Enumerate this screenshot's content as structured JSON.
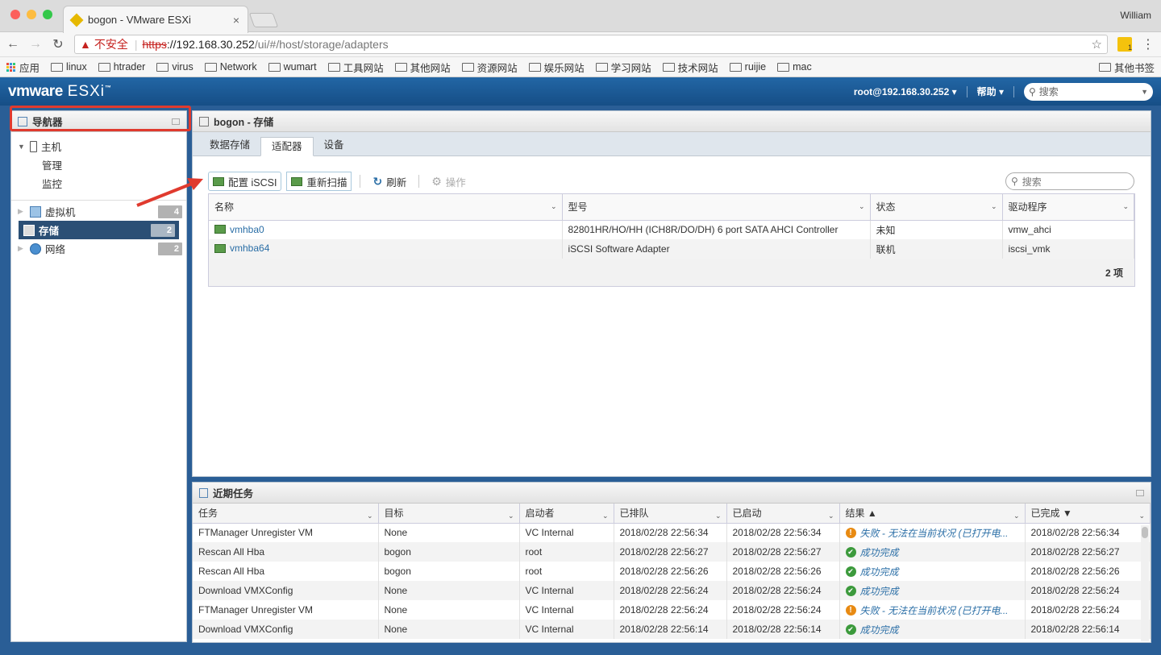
{
  "browser": {
    "tab_title": "bogon - VMware ESXi",
    "user": "William",
    "insecure_label": "不安全",
    "url_scheme": "https",
    "url_host": "://192.168.30.252",
    "url_path": "/ui/#/host/storage/adapters",
    "ext_badge": "1"
  },
  "bookmarks": {
    "apps": "应用",
    "items": [
      "linux",
      "htrader",
      "virus",
      "Network",
      "wumart",
      "工具网站",
      "其他网站",
      "资源网站",
      "娱乐网站",
      "学习网站",
      "技术网站",
      "ruijie",
      "mac"
    ],
    "other": "其他书签"
  },
  "header": {
    "logo": "vmware",
    "product": "ESXi",
    "user": "root@192.168.30.252",
    "help": "帮助",
    "search_placeholder": "搜索"
  },
  "navigator": {
    "title": "导航器",
    "host": "主机",
    "manage": "管理",
    "monitor": "监控",
    "vms": "虚拟机",
    "vms_count": "4",
    "storage": "存储",
    "storage_count": "2",
    "network": "网络",
    "network_count": "2"
  },
  "main": {
    "title": "bogon - 存储",
    "tabs": [
      "数据存储",
      "适配器",
      "设备"
    ],
    "toolbar": {
      "configure_iscsi": "配置 iSCSI",
      "rescan": "重新扫描",
      "refresh": "刷新",
      "actions": "操作",
      "search_placeholder": "搜索"
    },
    "columns": [
      "名称",
      "型号",
      "状态",
      "驱动程序"
    ],
    "rows": [
      [
        "vmhba0",
        "82801HR/HO/HH (ICH8R/DO/DH) 6 port SATA AHCI Controller",
        "未知",
        "vmw_ahci"
      ],
      [
        "vmhba64",
        "iSCSI Software Adapter",
        "联机",
        "iscsi_vmk"
      ]
    ],
    "count": "2 项"
  },
  "tasks": {
    "title": "近期任务",
    "columns": [
      "任务",
      "目标",
      "启动者",
      "已排队",
      "已启动",
      "结果 ▲",
      "已完成 ▼"
    ],
    "rows": [
      [
        "FTManager Unregister VM",
        "None",
        "VC Internal",
        "2018/02/28 22:56:34",
        "2018/02/28 22:56:34",
        "失败 - 无法在当前状况 (已打开电...",
        "2018/02/28 22:56:34",
        "fail"
      ],
      [
        "Rescan All Hba",
        "bogon",
        "root",
        "2018/02/28 22:56:27",
        "2018/02/28 22:56:27",
        "成功完成",
        "2018/02/28 22:56:27",
        "ok"
      ],
      [
        "Rescan All Hba",
        "bogon",
        "root",
        "2018/02/28 22:56:26",
        "2018/02/28 22:56:26",
        "成功完成",
        "2018/02/28 22:56:26",
        "ok"
      ],
      [
        "Download VMXConfig",
        "None",
        "VC Internal",
        "2018/02/28 22:56:24",
        "2018/02/28 22:56:24",
        "成功完成",
        "2018/02/28 22:56:24",
        "ok"
      ],
      [
        "FTManager Unregister VM",
        "None",
        "VC Internal",
        "2018/02/28 22:56:24",
        "2018/02/28 22:56:24",
        "失败 - 无法在当前状况 (已打开电...",
        "2018/02/28 22:56:24",
        "fail"
      ],
      [
        "Download VMXConfig",
        "None",
        "VC Internal",
        "2018/02/28 22:56:14",
        "2018/02/28 22:56:14",
        "成功完成",
        "2018/02/28 22:56:14",
        "ok"
      ]
    ]
  }
}
